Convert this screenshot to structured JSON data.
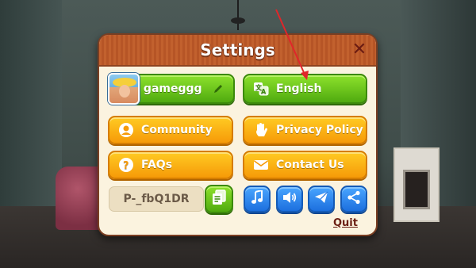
{
  "dialog": {
    "title": "Settings",
    "close_symbol": "✕"
  },
  "profile": {
    "username": "gameggg",
    "avatar_icon": "avatar-portrait-icon",
    "edit_icon": "pencil-icon"
  },
  "buttons": {
    "language": {
      "label": "English",
      "icon": "translate-icon"
    },
    "community": {
      "label": "Community",
      "icon": "community-icon"
    },
    "privacy": {
      "label": "Privacy Policy",
      "icon": "hand-icon"
    },
    "faqs": {
      "label": "FAQs",
      "icon": "question-icon"
    },
    "contact": {
      "label": "Contact Us",
      "icon": "envelope-icon"
    }
  },
  "player_id": {
    "value": "P-_fbQ1DR",
    "copy_icon": "copy-icon"
  },
  "toggles": [
    {
      "name": "music",
      "icon": "music-note-icon"
    },
    {
      "name": "sound",
      "icon": "speaker-icon"
    },
    {
      "name": "telegram",
      "icon": "paper-plane-icon"
    },
    {
      "name": "share",
      "icon": "share-icon"
    }
  ],
  "footer": {
    "quit_label": "Quit"
  },
  "colors": {
    "header": "#c2612e",
    "panel": "#fbf3df",
    "green": "#5cb814",
    "orange": "#f8a80e",
    "blue": "#2a84f0",
    "annotation_arrow": "#e0262a"
  }
}
